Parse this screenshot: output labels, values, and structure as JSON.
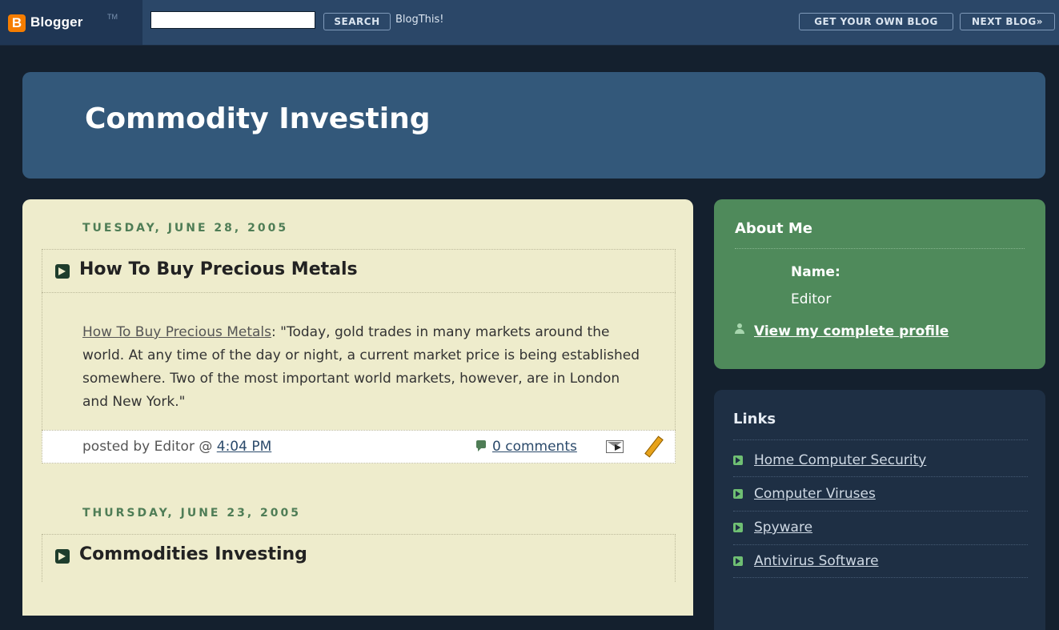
{
  "navbar": {
    "logo_letter": "B",
    "logo_text": "Blogger",
    "logo_tm": "TM",
    "search_value": "",
    "search_label": "SEARCH",
    "blogthis_label": "BlogThis!",
    "get_own_label": "GET YOUR OWN BLOG",
    "next_blog_label": "NEXT BLOG»"
  },
  "header": {
    "title": "Commodity Investing"
  },
  "posts": [
    {
      "date": "TUESDAY, JUNE 28, 2005",
      "title": "How To Buy Precious Metals",
      "link_text": "How To Buy Precious Metals",
      "body": ": \"Today, gold trades in many markets around the world. At any time of the day or night, a current market price is being established somewhere. Two of the most important world markets, however, are in London and New York.\"",
      "posted_by": "posted by Editor @ ",
      "time": "4:04 PM",
      "comments": "0 comments"
    },
    {
      "date": "THURSDAY, JUNE 23, 2005",
      "title": "Commodities Investing"
    }
  ],
  "about": {
    "heading": "About Me",
    "name_label": "Name:",
    "name_value": "Editor",
    "profile_link": "View my complete profile"
  },
  "links": {
    "heading": "Links",
    "items": [
      "Home Computer Security",
      "Computer Viruses",
      "Spyware",
      "Antivirus Software"
    ]
  },
  "colors": {
    "page_bg": "#14202e",
    "navbar_bg": "#2b4768",
    "header_bg": "#33587a",
    "main_bg": "#eeeccc",
    "about_bg": "#4f8a5b",
    "links_bg": "#1e2f44",
    "date_green": "#4f7d56",
    "logo_orange": "#f57d00"
  },
  "icons": [
    "blogger-logo-icon",
    "arrow-right-icon",
    "comment-icon",
    "email-post-icon",
    "pencil-edit-icon",
    "person-icon"
  ]
}
